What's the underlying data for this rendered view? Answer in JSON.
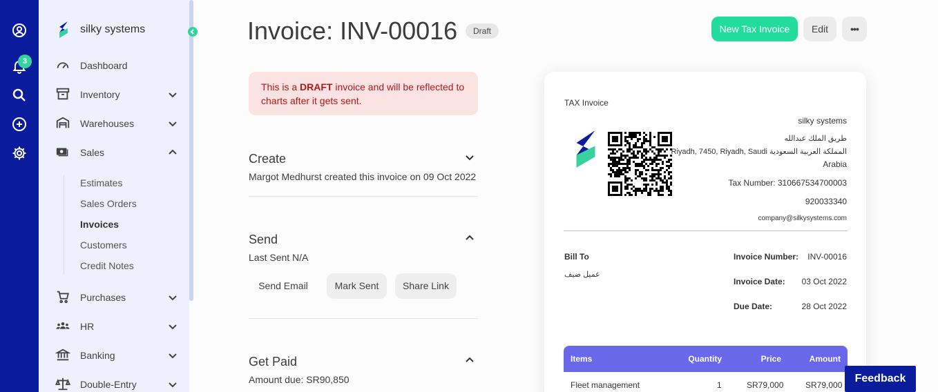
{
  "rail": {
    "notification_count": "3",
    "icons": [
      "user-circle-icon",
      "bell-icon",
      "search-icon",
      "plus-circle-icon",
      "gear-icon"
    ]
  },
  "sidebar": {
    "brand": "silky systems",
    "items": [
      {
        "label": "Dashboard",
        "icon": "gauge-icon"
      },
      {
        "label": "Inventory",
        "icon": "archive-icon"
      },
      {
        "label": "Warehouses",
        "icon": "warehouse-icon"
      },
      {
        "label": "Sales",
        "icon": "money-icon"
      },
      {
        "label": "Purchases",
        "icon": "cart-icon"
      },
      {
        "label": "HR",
        "icon": "people-icon"
      },
      {
        "label": "Banking",
        "icon": "bank-icon"
      },
      {
        "label": "Double-Entry",
        "icon": "scale-icon"
      }
    ],
    "sales_subitems": [
      "Estimates",
      "Sales Orders",
      "Invoices",
      "Customers",
      "Credit Notes"
    ]
  },
  "header": {
    "title": "Invoice: INV-00016",
    "status": "Draft",
    "new_tax_invoice": "New Tax Invoice",
    "edit": "Edit",
    "more": "•••"
  },
  "alert": {
    "prefix": "This is a ",
    "strong": "DRAFT",
    "suffix": " invoice and will be reflected to charts after it gets sent."
  },
  "sections": {
    "create_title": "Create",
    "create_text": "Margot Medhurst created this invoice on 09 Oct 2022",
    "send_title": "Send",
    "send_text": "Last Sent N/A",
    "send_email": "Send Email",
    "mark_sent": "Mark Sent",
    "share_link": "Share Link",
    "paid_title": "Get Paid",
    "paid_text": "Amount due: SR90,850"
  },
  "invoice": {
    "doc_type": "TAX Invoice",
    "company": "silky systems",
    "address_line1": "طريق الملك عبدالله",
    "address_line2": "Riyadh, 7450, Riyadh, Saudi المملكة العربية السعودية",
    "address_line3": "Arabia",
    "tax_number": "Tax Number: 310667534700003",
    "phone": "920033340",
    "email": "company@silkysystems.com",
    "bill_to_label": "Bill To",
    "bill_to_value": "عميل ضيف",
    "invoice_number_label": "Invoice Number:",
    "invoice_number": "INV-00016",
    "invoice_date_label": "Invoice Date:",
    "invoice_date": "03 Oct 2022",
    "due_date_label": "Due Date:",
    "due_date": "28 Oct 2022",
    "columns": {
      "items": "Items",
      "quantity": "Quantity",
      "price": "Price",
      "amount": "Amount"
    },
    "row": {
      "item": "Fleet management",
      "quantity": "1",
      "price": "SR79,000",
      "amount": "SR79,000"
    }
  },
  "feedback": "Feedback",
  "colors": {
    "rail": "#0a1c9c",
    "accent": "#22dc9d",
    "items_header": "#6868e9",
    "alert_bg": "#fbe3e3",
    "alert_text": "#b21818"
  }
}
